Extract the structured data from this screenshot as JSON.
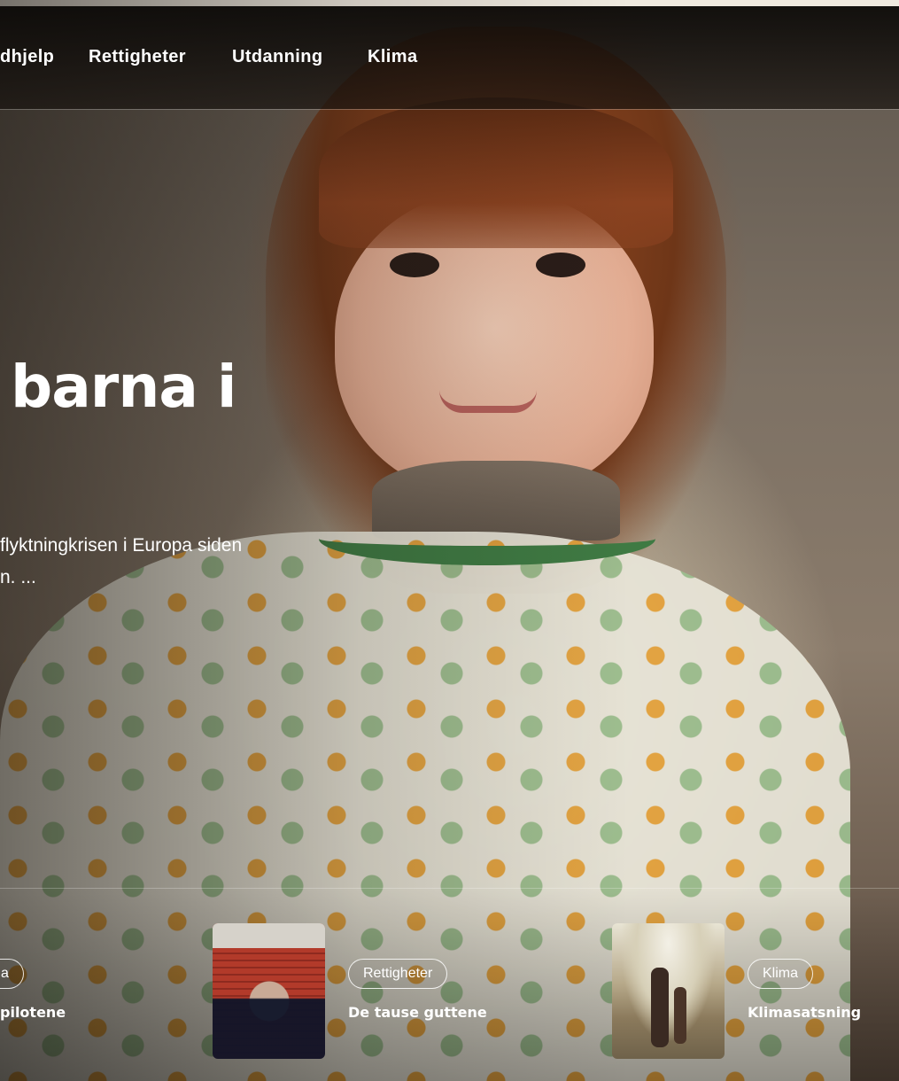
{
  "nav": {
    "items": [
      {
        "label": "dhjelp"
      },
      {
        "label": "Rettigheter"
      },
      {
        "label": "Utdanning"
      },
      {
        "label": "Klima"
      }
    ]
  },
  "hero": {
    "headline": "barna i",
    "lede_line1": "flyktningkrisen i Europa siden",
    "lede_line2": "n. ..."
  },
  "cards": [
    {
      "tag": "a",
      "title": "pilotene"
    },
    {
      "tag": "Rettigheter",
      "title": "De tause guttene"
    },
    {
      "tag": "Klima",
      "title": "Klimasatsning"
    }
  ]
}
